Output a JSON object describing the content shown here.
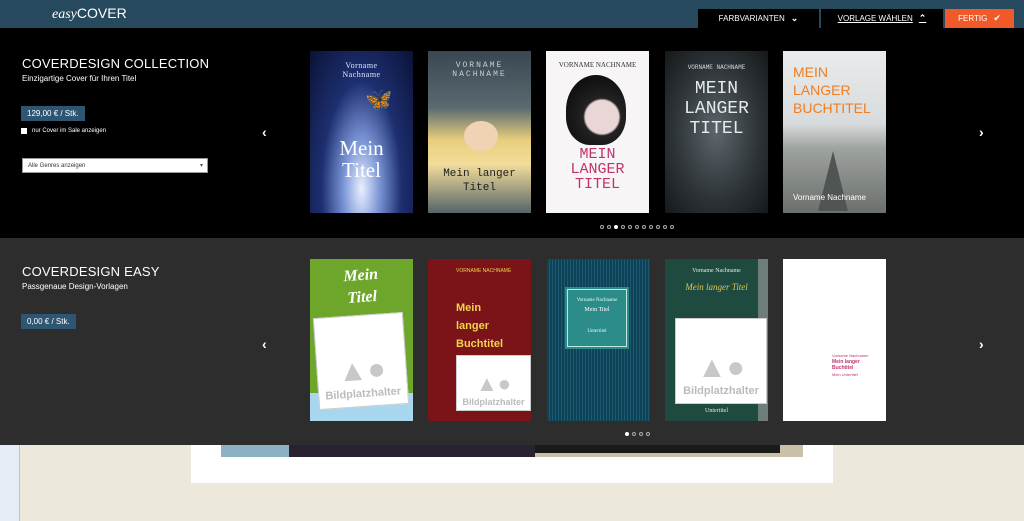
{
  "header": {
    "logo_prefix": "easy",
    "logo_main": "COVER",
    "buttons": [
      "FARBVARIANTEN",
      "VORLAGE WÄHLEN",
      "FERTIG"
    ]
  },
  "collection": {
    "title": "COVERDESIGN COLLECTION",
    "subtitle": "Einzigartige Cover für Ihren Titel",
    "price": "129,00 € / Stk.",
    "sale_checkbox": "nur Cover im Sale anzeigen",
    "genre_select": "Alle Genres anzeigen",
    "covers": [
      {
        "author": "Vorname\nNachname",
        "title": "Mein\nTitel"
      },
      {
        "author": "VORNAME\nNACHNAME",
        "title": "Mein langer\nTitel"
      },
      {
        "author": "VORNAME NACHNAME",
        "title": "MEIN\nLANGER\nTITEL"
      },
      {
        "author": "VORNAME NACHNAME",
        "title": "MEIN\nLANGER\nTITEL"
      },
      {
        "author": "Vorname Nachname",
        "title": "MEIN\nLANGER\nBUCHTITEL"
      }
    ]
  },
  "easy": {
    "title": "COVERDESIGN EASY",
    "subtitle": "Passgenaue Design-Vorlagen",
    "price": "0,00 € / Stk.",
    "covers": [
      {
        "title": "Mein\nTitel",
        "placeholder": "Bildplatzhalter"
      },
      {
        "author": "VORNAME NACHNAME",
        "title": "Mein\nlanger\nBuchtitel",
        "placeholder": "Bildplatzhalter"
      },
      {
        "author": "Vorname Nachname",
        "title": "Mein Titel",
        "subtitle": "Untertitel"
      },
      {
        "author": "Vorname Nachname",
        "title": "Mein langer Titel",
        "placeholder": "Bildplatzhalter",
        "subtitle": "Untertitel"
      },
      {
        "author": "Vorname Nachname",
        "title": "Mein langer\nBuchtitel",
        "subtitle": "Mein Untertitel"
      }
    ]
  },
  "colors": {
    "accent": "#f05a28",
    "header": "#26495e",
    "price": "#2e5672"
  }
}
